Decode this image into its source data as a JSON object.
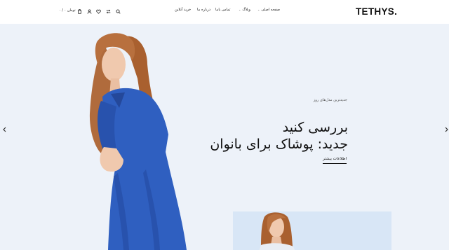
{
  "header": {
    "logo": "TETHYS",
    "nav": [
      {
        "label": "صفحه اصلی",
        "has_dropdown": true
      },
      {
        "label": "وبلاگ",
        "has_dropdown": true
      },
      {
        "label": "تماس باما",
        "has_dropdown": false
      },
      {
        "label": "درباره ما",
        "has_dropdown": false
      },
      {
        "label": "خرید آنلاین",
        "has_dropdown": false
      }
    ],
    "cart_amount": "۰ / ۰ تومان",
    "icons": [
      "cart-icon",
      "user-icon",
      "heart-icon",
      "compare-icon",
      "search-icon"
    ]
  },
  "hero": {
    "subtitle": "جدیدترین مدل‌های روز",
    "title_line1": "بررسی کنید",
    "title_line2": "جدید: پوشاک برای بانوان",
    "cta": "اطلاعات بیشتر",
    "background_color": "#edf2f9",
    "dress_color": "#2f5fc0"
  }
}
